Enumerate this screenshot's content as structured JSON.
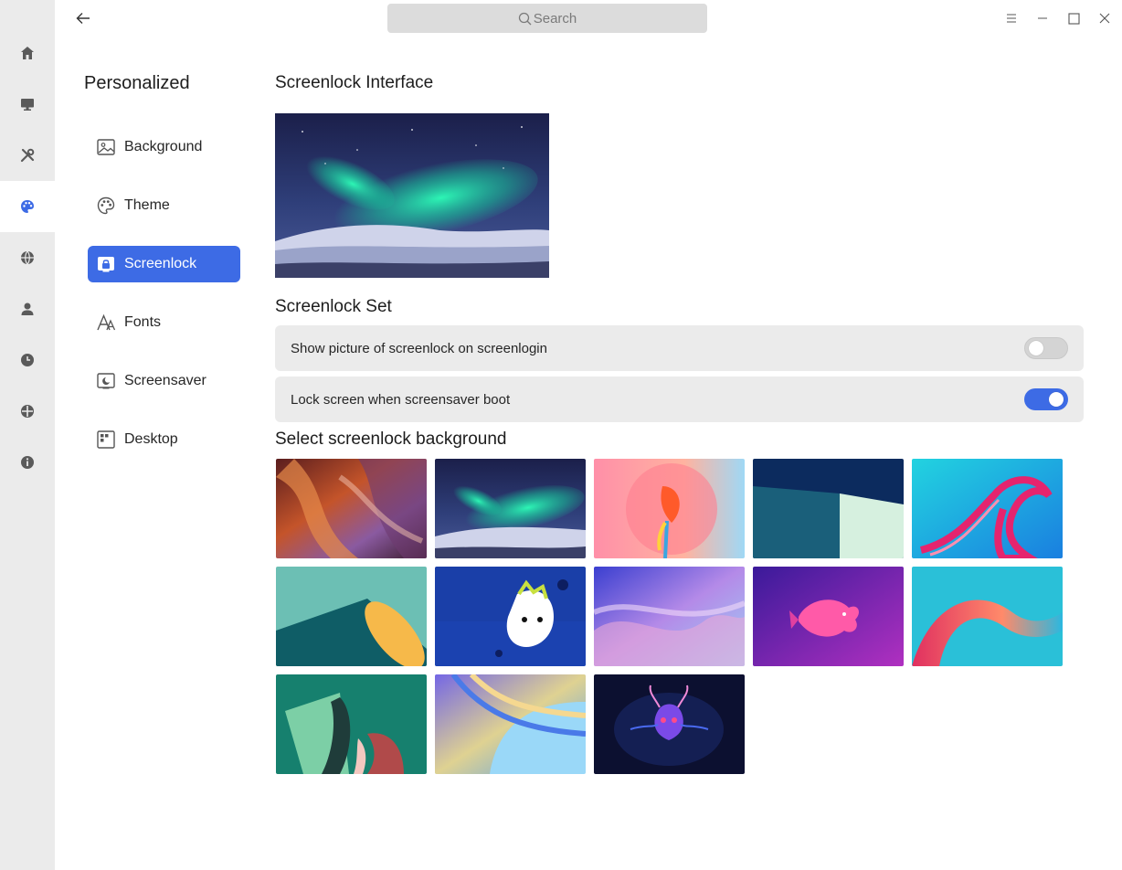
{
  "search": {
    "placeholder": "Search"
  },
  "rail": {
    "items": [
      {
        "icon": "home-icon"
      },
      {
        "icon": "monitor-icon"
      },
      {
        "icon": "tools-icon"
      },
      {
        "icon": "palette-icon",
        "active": true
      },
      {
        "icon": "globe-icon"
      },
      {
        "icon": "user-icon"
      },
      {
        "icon": "clock-icon"
      },
      {
        "icon": "update-icon"
      },
      {
        "icon": "info-icon"
      }
    ]
  },
  "nav": {
    "title": "Personalized",
    "items": [
      {
        "label": "Background",
        "icon": "image-icon"
      },
      {
        "label": "Theme",
        "icon": "palette-icon"
      },
      {
        "label": "Screenlock",
        "icon": "screenlock-icon",
        "active": true
      },
      {
        "label": "Fonts",
        "icon": "fonts-icon"
      },
      {
        "label": "Screensaver",
        "icon": "screensaver-icon"
      },
      {
        "label": "Desktop",
        "icon": "desktop-icon"
      }
    ]
  },
  "main": {
    "interface_title": "Screenlock Interface",
    "set_title": "Screenlock Set",
    "settings": [
      {
        "label": "Show picture of screenlock on screenlogin",
        "enabled": false
      },
      {
        "label": "Lock screen when screensaver boot",
        "enabled": true
      }
    ],
    "select_title": "Select screenlock background",
    "wallpapers": [
      "canyon",
      "aurora",
      "pink-flower",
      "teal-geometric",
      "pink-ribbon",
      "teal-dune",
      "blue-cat",
      "purple-wave",
      "purple-fish",
      "ribbon-wave",
      "green-fold",
      "blue-swirl",
      "dark-creature"
    ]
  },
  "colors": {
    "accent": "#3d6be5",
    "rail_bg": "#ebebeb",
    "row_bg": "#ebebeb"
  }
}
